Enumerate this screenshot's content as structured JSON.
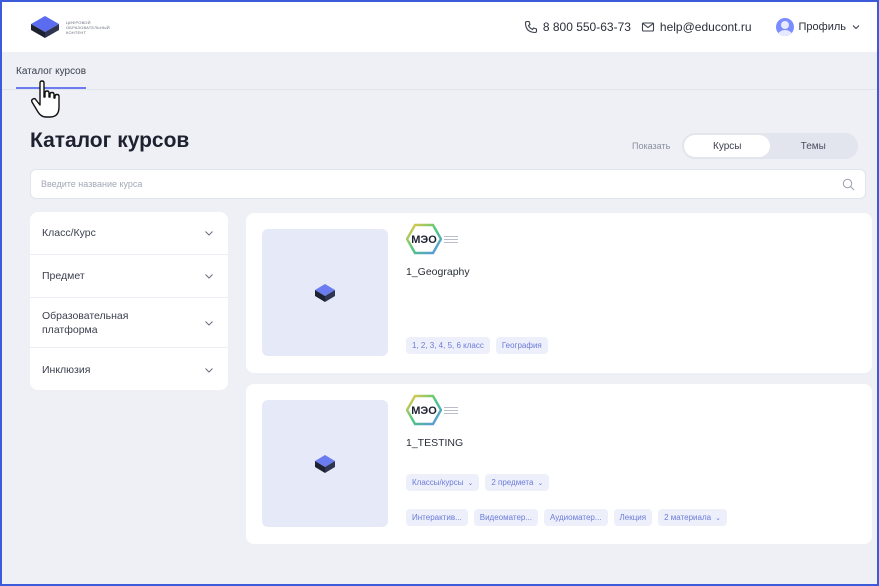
{
  "header": {
    "logo_lines": [
      "ЦИФРОВОЙ",
      "ОБРАЗОВАТЕЛЬНЫЙ",
      "КОНТЕНТ"
    ],
    "phone": "8 800 550-63-73",
    "email": "help@educont.ru",
    "profile_label": "Профиль"
  },
  "breadcrumb": {
    "current": "Каталог курсов"
  },
  "page": {
    "title": "Каталог курсов"
  },
  "view_toggle": {
    "label": "Показать",
    "options": [
      {
        "label": "Курсы",
        "active": true
      },
      {
        "label": "Темы",
        "active": false
      }
    ]
  },
  "search": {
    "placeholder": "Введите название курса",
    "value": ""
  },
  "filters": [
    {
      "label": "Класс/Курс"
    },
    {
      "label": "Предмет"
    },
    {
      "label": "Образовательная платформа"
    },
    {
      "label": "Инклюзия"
    }
  ],
  "courses": [
    {
      "provider_logo": "МЭО",
      "title": "1_Geography",
      "tag_rows": [
        [
          {
            "label": "1, 2, 3, 4, 5, 6 класс"
          },
          {
            "label": "География"
          }
        ]
      ]
    },
    {
      "provider_logo": "МЭО",
      "title": "1_TESTING",
      "tag_rows": [
        [
          {
            "label": "Классы/курсы",
            "dropdown": true
          },
          {
            "label": "2 предмета",
            "dropdown": true
          }
        ],
        [
          {
            "label": "Интерактив..."
          },
          {
            "label": "Видеоматер..."
          },
          {
            "label": "Аудиоматер..."
          },
          {
            "label": "Лекция"
          },
          {
            "label": "2 материала",
            "dropdown": true
          }
        ]
      ]
    }
  ],
  "colors": {
    "accent": "#6b7cf0",
    "background": "#eef0f5",
    "tag_bg": "#edf0fb",
    "tag_text": "#6b7bd8"
  },
  "icons": {
    "phone": "phone-icon",
    "email": "mail-icon",
    "search": "search-icon",
    "chevron": "chevron-down-icon",
    "cursor": "hand-pointer-icon"
  }
}
